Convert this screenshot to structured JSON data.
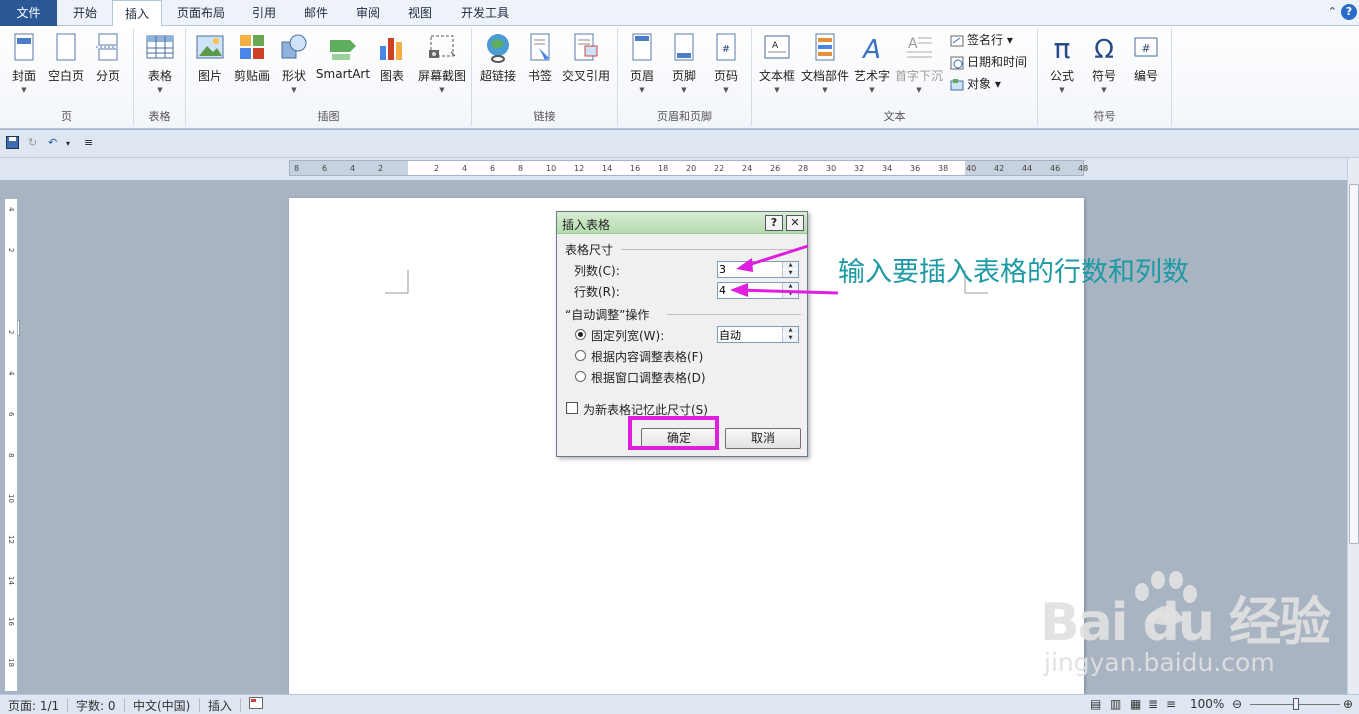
{
  "tabs": [
    {
      "label": "文件"
    },
    {
      "label": "开始"
    },
    {
      "label": "插入"
    },
    {
      "label": "页面布局"
    },
    {
      "label": "引用"
    },
    {
      "label": "邮件"
    },
    {
      "label": "审阅"
    },
    {
      "label": "视图"
    },
    {
      "label": "开发工具"
    }
  ],
  "ribbon": {
    "groups": [
      {
        "label": "页",
        "buttons": [
          "封面",
          "空白页",
          "分页"
        ]
      },
      {
        "label": "表格",
        "buttons": [
          "表格"
        ]
      },
      {
        "label": "插图",
        "buttons": [
          "图片",
          "剪贴画",
          "形状",
          "SmartArt",
          "图表",
          "屏幕截图"
        ]
      },
      {
        "label": "链接",
        "buttons": [
          "超链接",
          "书签",
          "交叉引用"
        ]
      },
      {
        "label": "页眉和页脚",
        "buttons": [
          "页眉",
          "页脚",
          "页码"
        ]
      },
      {
        "label": "文本",
        "buttons": [
          "文本框",
          "文档部件",
          "艺术字",
          "首字下沉"
        ],
        "small": [
          "签名行 ▾",
          "日期和时间",
          "对象 ▾"
        ]
      },
      {
        "label": "符号",
        "buttons": [
          "公式",
          "符号",
          "编号"
        ]
      }
    ]
  },
  "ruler_ticks": [
    "8",
    "6",
    "4",
    "2",
    "",
    "2",
    "4",
    "6",
    "8",
    "10",
    "12",
    "14",
    "16",
    "18",
    "20",
    "22",
    "24",
    "26",
    "28",
    "30",
    "32",
    "34",
    "36",
    "38",
    "40",
    "42",
    "44",
    "46",
    "48"
  ],
  "vruler_ticks": [
    "4",
    "2",
    "",
    "2",
    "4",
    "6",
    "8",
    "10",
    "12",
    "14",
    "16",
    "18"
  ],
  "dialog": {
    "title": "插入表格",
    "help": "?",
    "close": "✕",
    "section_size": "表格尺寸",
    "columns_label": "列数(C):",
    "columns_value": "3",
    "rows_label": "行数(R):",
    "rows_value": "4",
    "section_autofit": "“自动调整”操作",
    "fixed_width_label": "固定列宽(W):",
    "fixed_width_value": "自动",
    "autofit_content": "根据内容调整表格(F)",
    "autofit_window": "根据窗口调整表格(D)",
    "remember": "为新表格记忆此尺寸(S)",
    "ok": "确定",
    "cancel": "取消"
  },
  "annotation": "输入要插入表格的行数和列数",
  "status": {
    "page": "页面: 1/1",
    "words": "字数: 0",
    "lang": "中文(中国)",
    "mode": "插入",
    "zoom": "100%"
  },
  "watermark": {
    "brand": "Bai  du 经验",
    "url": "jingyan.baidu.com"
  },
  "colors": {
    "highlight": "#e01ee0",
    "annotation": "#1e9aa5",
    "file_tab": "#2b5797"
  }
}
